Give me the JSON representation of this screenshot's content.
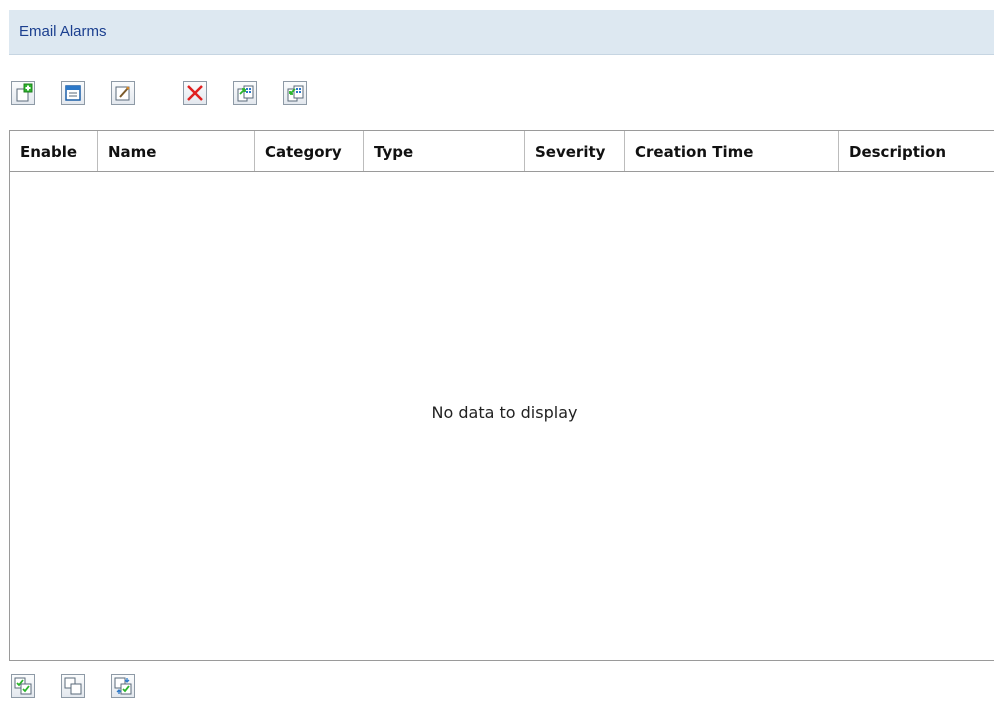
{
  "panel": {
    "title": "Email Alarms"
  },
  "toolbar": {
    "buttons": [
      {
        "name": "add-alarm-button",
        "icon": "add-document-icon"
      },
      {
        "name": "copy-alarm-button",
        "icon": "window-icon"
      },
      {
        "name": "edit-alarm-button",
        "icon": "edit-pencil-icon"
      },
      {
        "name": "delete-alarm-button",
        "icon": "delete-x-icon"
      },
      {
        "name": "export-button",
        "icon": "export-icon"
      },
      {
        "name": "import-button",
        "icon": "import-icon"
      }
    ]
  },
  "table": {
    "columns": [
      "Enable",
      "Name",
      "Category",
      "Type",
      "Severity",
      "Creation Time",
      "Description"
    ],
    "empty_message": "No data to display"
  },
  "footer": {
    "buttons": [
      {
        "name": "enable-selected-button",
        "icon": "enable-check-icon"
      },
      {
        "name": "disable-selected-button",
        "icon": "disable-icon"
      },
      {
        "name": "toggle-selected-button",
        "icon": "toggle-check-icon"
      }
    ]
  },
  "colors": {
    "header_bg": "#dde8f1",
    "title_text": "#1b3f8f",
    "delete_red": "#e02020",
    "add_green": "#2bb52b"
  }
}
